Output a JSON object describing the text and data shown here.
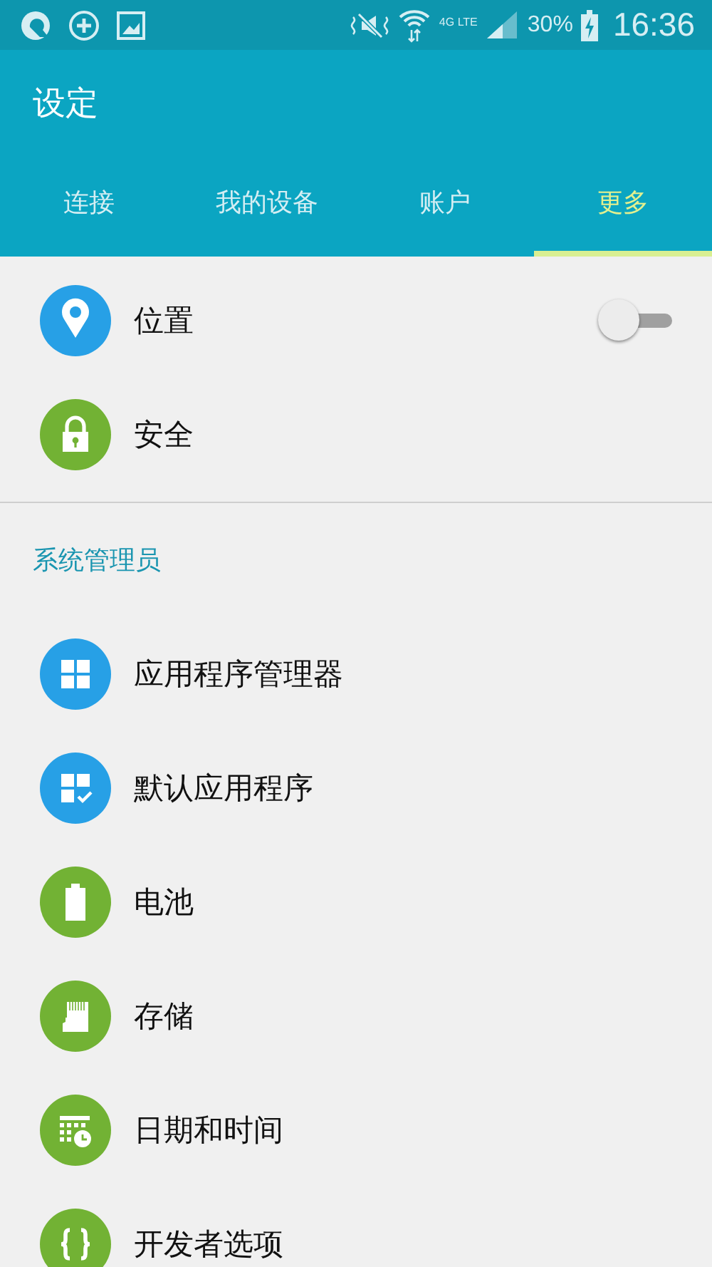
{
  "status_bar": {
    "network": "4G LTE",
    "battery": "30%",
    "time": "16:36"
  },
  "app_bar": {
    "title": "设定"
  },
  "tabs": [
    {
      "label": "连接",
      "selected": false
    },
    {
      "label": "我的设备",
      "selected": false
    },
    {
      "label": "账户",
      "selected": false
    },
    {
      "label": "更多",
      "selected": true
    }
  ],
  "sections": [
    {
      "items": [
        {
          "label": "位置",
          "kind": "location",
          "color": "#27a0e6",
          "switch": {
            "on": false
          }
        },
        {
          "label": "安全",
          "kind": "lock",
          "color": "#72b234"
        }
      ]
    },
    {
      "header": "系统管理员",
      "items": [
        {
          "label": "应用程序管理器",
          "kind": "grid",
          "color": "#27a0e6"
        },
        {
          "label": "默认应用程序",
          "kind": "grid-check",
          "color": "#27a0e6"
        },
        {
          "label": "电池",
          "kind": "battery",
          "color": "#72b234"
        },
        {
          "label": "存储",
          "kind": "sd-card",
          "color": "#72b234"
        },
        {
          "label": "日期和时间",
          "kind": "calendar",
          "color": "#72b234"
        },
        {
          "label": "开发者选项",
          "kind": "braces",
          "color": "#72b234"
        }
      ]
    }
  ]
}
